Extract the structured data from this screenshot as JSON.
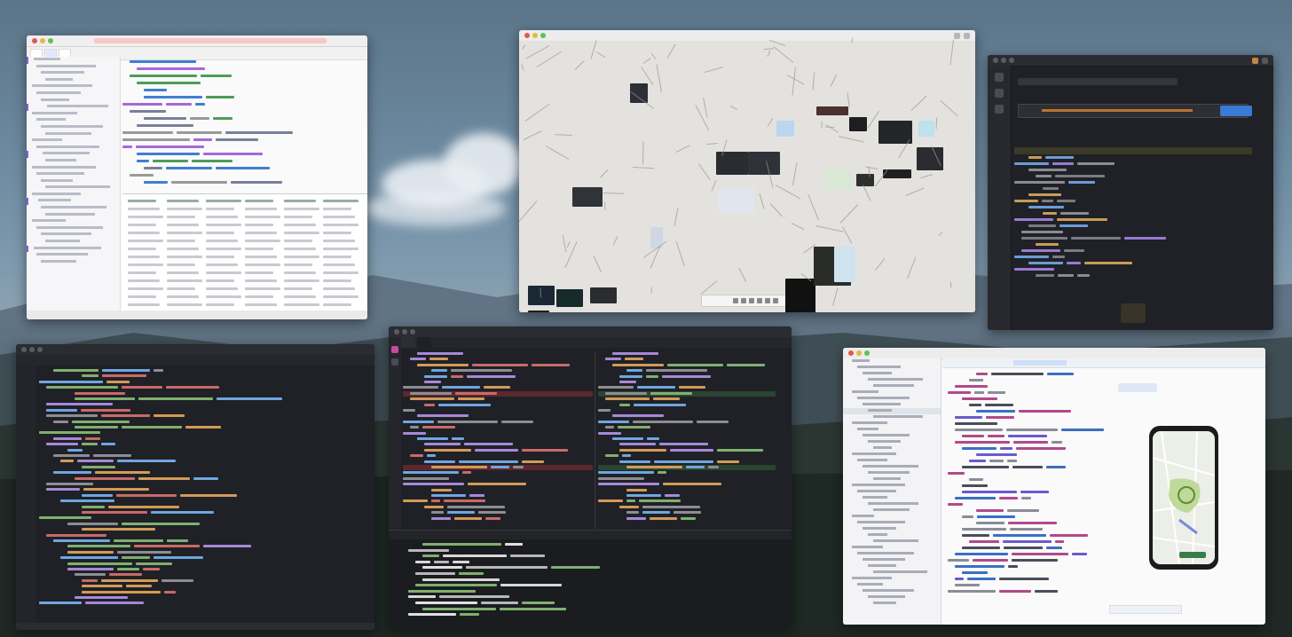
{
  "desktop": {
    "colors": {
      "sky_top": "#5b7488",
      "horizon": "#8ea2b0",
      "forest": "#2e3a37"
    }
  },
  "windows": [
    {
      "id": "window-1",
      "theme": "light",
      "tabs": [
        "",
        "",
        ""
      ],
      "sidebar_items": [
        "",
        "",
        "",
        "",
        "",
        "",
        "",
        "",
        "",
        "",
        "",
        "",
        "",
        "",
        "",
        "",
        "",
        "",
        "",
        "",
        "",
        "",
        "",
        "",
        "",
        "",
        "",
        "",
        "",
        "",
        ""
      ],
      "status": ""
    },
    {
      "id": "window-2",
      "theme": "light",
      "title": "",
      "kind": "whiteboard-canvas"
    },
    {
      "id": "window-3",
      "theme": "dark",
      "title": "",
      "search_button": "",
      "tabs": ""
    },
    {
      "id": "window-4",
      "theme": "dark",
      "title": "",
      "kind": "code-editor"
    },
    {
      "id": "window-5",
      "theme": "dark",
      "title": "",
      "tabs": [
        "",
        ""
      ],
      "kind": "diff-editor-with-terminal"
    },
    {
      "id": "window-6",
      "theme": "light",
      "title": "",
      "preview_tab": "",
      "kind": "ide-with-phone-preview"
    }
  ],
  "icons": [
    "close-icon",
    "minimize-icon",
    "maximize-icon",
    "search-icon",
    "phone-preview-icon"
  ]
}
